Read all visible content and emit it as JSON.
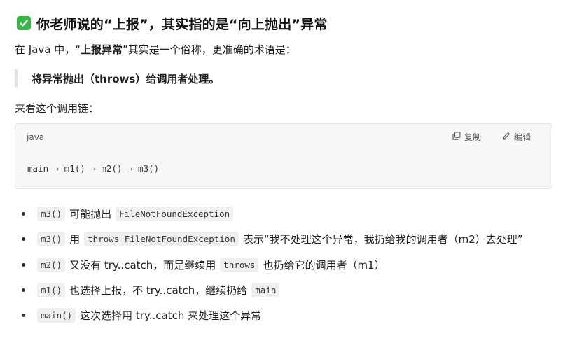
{
  "heading": {
    "icon": "checkmark-box-icon",
    "icon_color": "#3bb54a",
    "text": "你老师说的“上报”，其实指的是“向上抛出”异常"
  },
  "intro": {
    "prefix": "在 Java 中，“",
    "bold": "上报异常",
    "suffix": "”其实是一个俗称，更准确的术语是："
  },
  "quote": {
    "text": "将异常抛出（throws）给调用者处理。"
  },
  "chain_intro": "来看这个调用链：",
  "code": {
    "lang": "java",
    "copy_label": "复制",
    "copy_icon": "copy-icon",
    "edit_label": "编辑",
    "edit_icon": "edit-icon",
    "line": "main → m1() → m2() → m3()"
  },
  "bullets": [
    {
      "code1": "m3()",
      "text1": "可能抛出",
      "code2": "FileNotFoundException",
      "text2": ""
    },
    {
      "code1": "m3()",
      "text1": "用",
      "code2": "throws FileNotFoundException",
      "text2": "表示“我不处理这个异常，我扔给我的调用者（m2）去处理”"
    },
    {
      "code1": "m2()",
      "text1": "又没有 try..catch，而是继续用",
      "code2": "throws",
      "text2": "也扔给它的调用者（m1）"
    },
    {
      "code1": "m1()",
      "text1": "也选择上报，不 try..catch，继续扔给",
      "code2": "main",
      "text2": ""
    },
    {
      "code1": "main()",
      "text1": "这次选择用 try..catch 来处理这个异常",
      "code2": "",
      "text2": ""
    }
  ]
}
